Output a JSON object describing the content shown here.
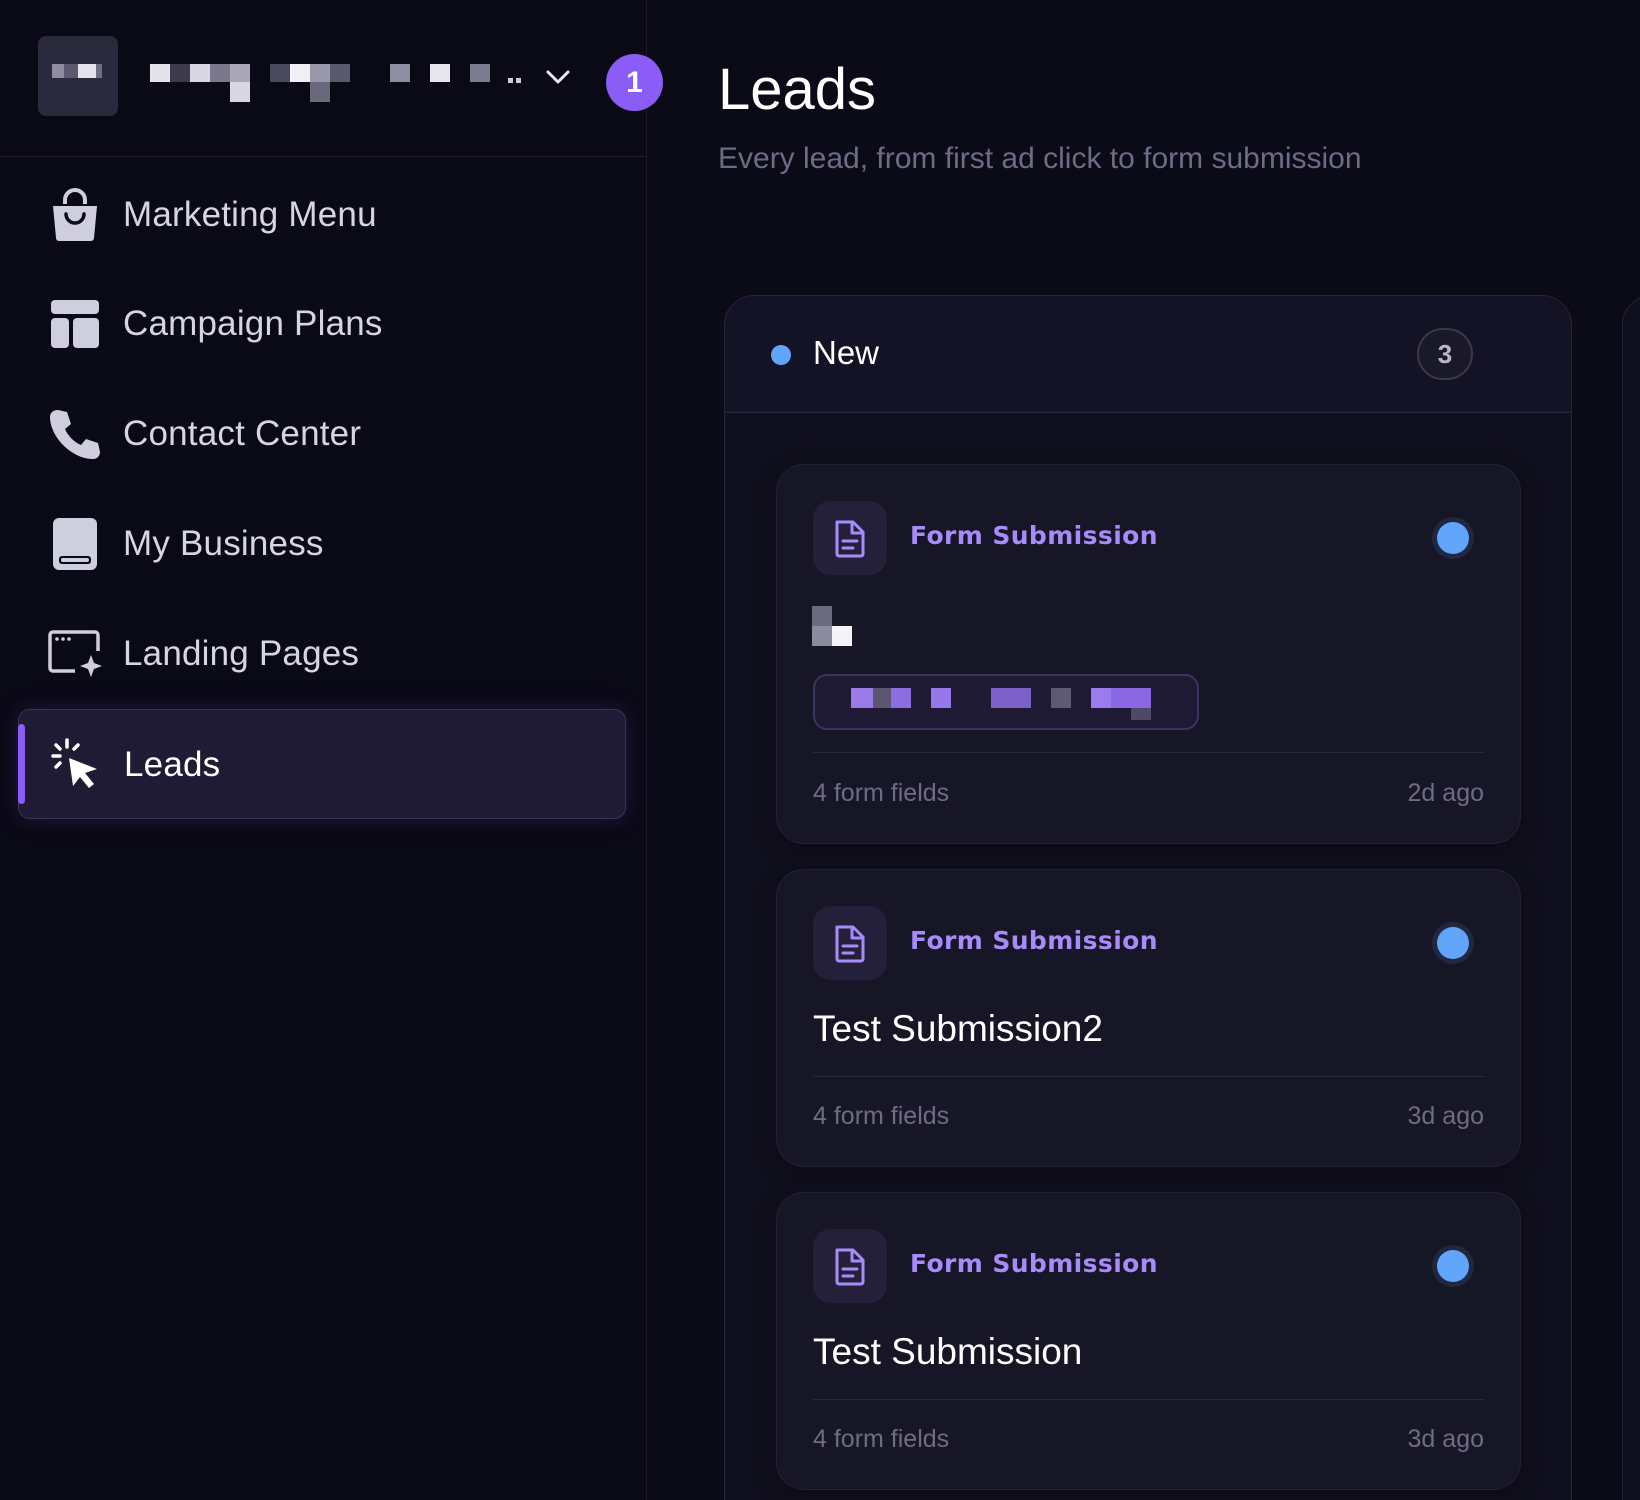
{
  "workspace": {
    "name": "█████ █████ ████..",
    "notification_count": "1",
    "avatar_icon": "redacted-avatar",
    "chevron_icon": "chevron-down-icon"
  },
  "sidebar": {
    "items": [
      {
        "label": "Marketing Menu",
        "icon": "shopping-bag-icon",
        "active": false
      },
      {
        "label": "Campaign Plans",
        "icon": "layout-grid-icon",
        "active": false
      },
      {
        "label": "Contact Center",
        "icon": "phone-icon",
        "active": false
      },
      {
        "label": "My Business",
        "icon": "book-icon",
        "active": false
      },
      {
        "label": "Landing Pages",
        "icon": "browser-sparkle-icon",
        "active": false
      },
      {
        "label": "Leads",
        "icon": "cursor-click-icon",
        "active": true
      }
    ]
  },
  "page": {
    "title": "Leads",
    "subtitle": "Every lead, from first ad click to form submission"
  },
  "columns": [
    {
      "title": "New",
      "count": "3",
      "dot_color": "#60a5fa",
      "cards": [
        {
          "type": "Form Submission",
          "name": "██",
          "name_redacted": true,
          "tag_redacted": true,
          "fields": "4 form fields",
          "time": "2d ago",
          "status_color": "#60a5fa"
        },
        {
          "type": "Form Submission",
          "name": "Test Submission2",
          "fields": "4 form fields",
          "time": "3d ago",
          "status_color": "#60a5fa"
        },
        {
          "type": "Form Submission",
          "name": "Test Submission",
          "fields": "4 form fields",
          "time": "3d ago",
          "status_color": "#60a5fa"
        }
      ]
    }
  ],
  "colors": {
    "accent": "#8b5cf6",
    "accent_text": "#a78bfa",
    "status_new": "#60a5fa",
    "background": "#0b0a17"
  }
}
